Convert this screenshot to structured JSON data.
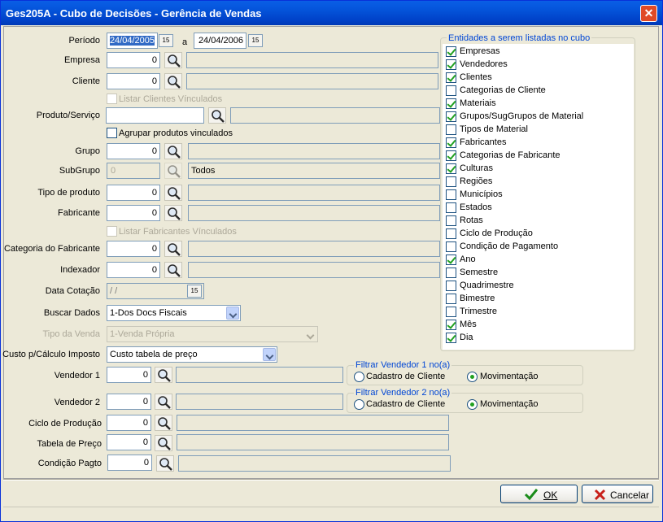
{
  "window": {
    "title": "Ges205A - Cubo de Decisões - Gerência de Vendas",
    "close": "✕"
  },
  "form": {
    "periodo": {
      "label": "Período",
      "from": "24/04/2005",
      "sep": "a",
      "to": "24/04/2006"
    },
    "empresa": {
      "label": "Empresa",
      "value": "0",
      "desc": ""
    },
    "cliente": {
      "label": "Cliente",
      "value": "0",
      "desc": ""
    },
    "listar_clientes": {
      "label": "Listar Clientes Vínculados",
      "checked": false
    },
    "produto": {
      "label": "Produto/Serviço",
      "value": "",
      "desc": ""
    },
    "agrupar_produtos": {
      "label": "Agrupar produtos vinculados",
      "checked": false
    },
    "grupo": {
      "label": "Grupo",
      "value": "0",
      "desc": ""
    },
    "subgrupo": {
      "label": "SubGrupo",
      "value": "0",
      "desc": "Todos"
    },
    "tipo_produto": {
      "label": "Tipo de produto",
      "value": "0",
      "desc": ""
    },
    "fabricante": {
      "label": "Fabricante",
      "value": "0",
      "desc": ""
    },
    "listar_fabricantes": {
      "label": "Listar Fabricantes Vínculados",
      "checked": false
    },
    "categoria_fabricante": {
      "label": "Categoria do Fabricante",
      "value": "0",
      "desc": ""
    },
    "indexador": {
      "label": "Indexador",
      "value": "0",
      "desc": ""
    },
    "data_cotacao": {
      "label": "Data Cotação",
      "value": " /  /"
    },
    "buscar_dados": {
      "label": "Buscar Dados",
      "value": "1-Dos Docs Fiscais"
    },
    "tipo_venda": {
      "label": "Tipo da Venda",
      "value": "1-Venda Própria"
    },
    "custo": {
      "label": "Custo p/Cálculo Imposto",
      "value": "Custo tabela de preço"
    },
    "vendedor1": {
      "label": "Vendedor 1",
      "value": "0",
      "desc": ""
    },
    "vendedor2": {
      "label": "Vendedor 2",
      "value": "0",
      "desc": ""
    },
    "ciclo": {
      "label": "Ciclo de Produção",
      "value": "0",
      "desc": ""
    },
    "tabela_preco": {
      "label": "Tabela de Preço",
      "value": "0",
      "desc": ""
    },
    "condicao_pagto": {
      "label": "Condição Pagto",
      "value": "0",
      "desc": ""
    }
  },
  "filtro1": {
    "title": "Filtrar Vendedor 1 no(a)",
    "opt1": "Cadastro de Cliente",
    "opt2": "Movimentação",
    "selected": "Movimentação"
  },
  "filtro2": {
    "title": "Filtrar Vendedor 2 no(a)",
    "opt1": "Cadastro de Cliente",
    "opt2": "Movimentação",
    "selected": "Movimentação"
  },
  "entidades": {
    "title": "Entidades a serem listadas no cubo",
    "items": [
      {
        "label": "Empresas",
        "checked": true
      },
      {
        "label": "Vendedores",
        "checked": true
      },
      {
        "label": "Clientes",
        "checked": true
      },
      {
        "label": "Categorias de Cliente",
        "checked": false
      },
      {
        "label": "Materiais",
        "checked": true
      },
      {
        "label": "Grupos/SugGrupos de Material",
        "checked": true
      },
      {
        "label": "Tipos de Material",
        "checked": false
      },
      {
        "label": "Fabricantes",
        "checked": true
      },
      {
        "label": "Categorias de Fabricante",
        "checked": true
      },
      {
        "label": "Culturas",
        "checked": true
      },
      {
        "label": "Regiões",
        "checked": false
      },
      {
        "label": "Municípios",
        "checked": false
      },
      {
        "label": "Estados",
        "checked": false
      },
      {
        "label": "Rotas",
        "checked": false
      },
      {
        "label": "Ciclo de Produção",
        "checked": false
      },
      {
        "label": "Condição de Pagamento",
        "checked": false
      },
      {
        "label": "Ano",
        "checked": true
      },
      {
        "label": "Semestre",
        "checked": false
      },
      {
        "label": "Quadrimestre",
        "checked": false
      },
      {
        "label": "Bimestre",
        "checked": false
      },
      {
        "label": "Trimestre",
        "checked": false
      },
      {
        "label": "Mês",
        "checked": true
      },
      {
        "label": "Dia",
        "checked": true
      }
    ]
  },
  "buttons": {
    "ok": "OK",
    "cancel": "Cancelar"
  },
  "calendar_glyph": "15"
}
